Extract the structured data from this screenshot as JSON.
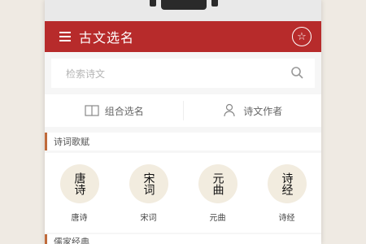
{
  "header": {
    "title": "古文选名",
    "menu_icon": "menu-icon",
    "star_icon": "star-icon"
  },
  "search": {
    "placeholder": "检索诗文"
  },
  "nav": [
    {
      "label": "组合选名",
      "icon": "book-icon"
    },
    {
      "label": "诗文作者",
      "icon": "user-icon"
    }
  ],
  "sections": {
    "first": {
      "label": "诗词歌赋"
    },
    "second": {
      "label": "儒家经典"
    }
  },
  "categories": [
    {
      "seal_text": "唐诗",
      "label": "唐诗"
    },
    {
      "seal_text": "宋词",
      "label": "宋词"
    },
    {
      "seal_text": "元曲",
      "label": "元曲"
    },
    {
      "seal_text": "诗经",
      "label": "诗经"
    }
  ],
  "colors": {
    "accent": "#b72b2b",
    "section_bar": "#c06a3a"
  }
}
